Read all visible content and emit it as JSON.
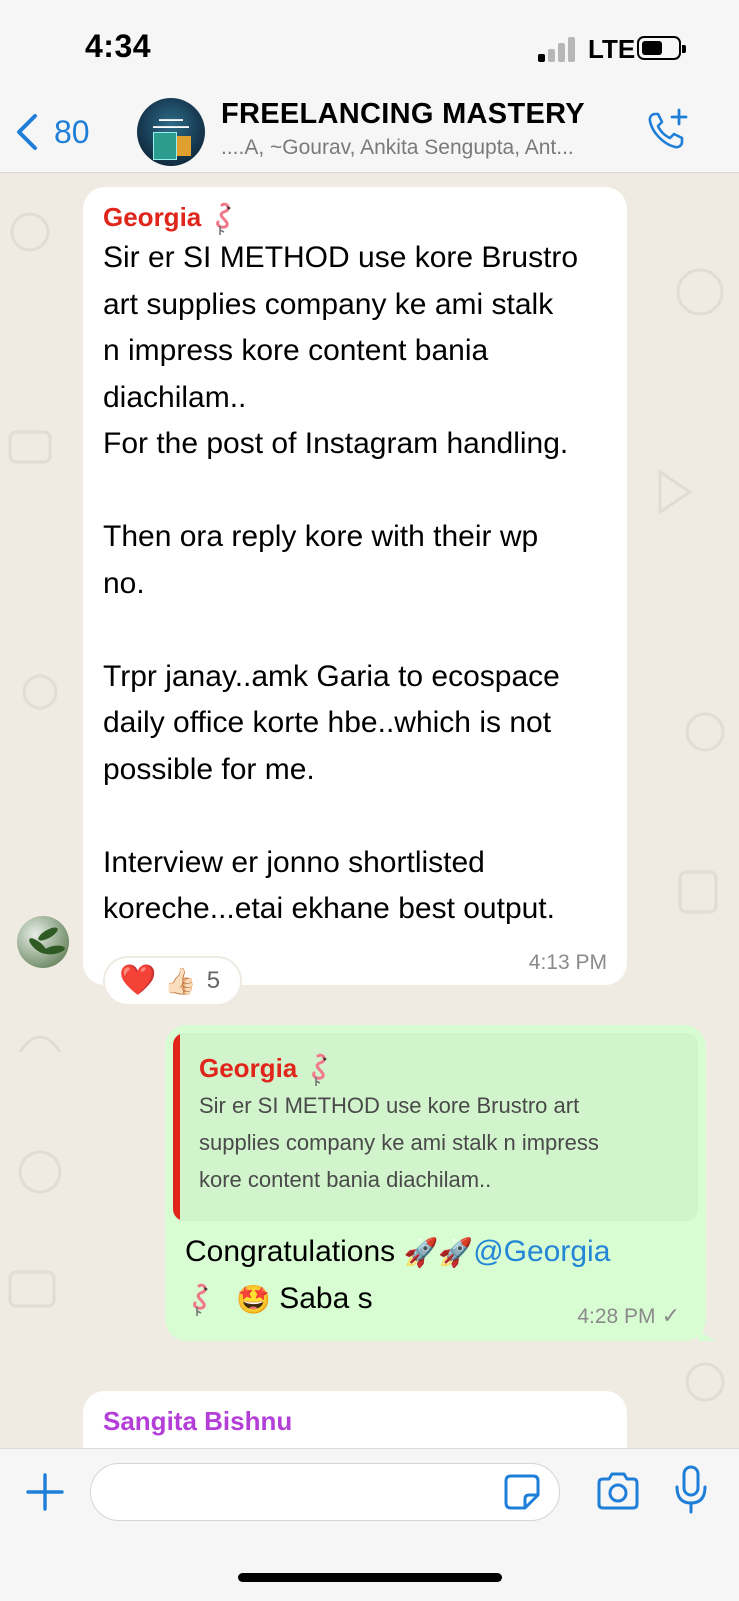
{
  "status_bar": {
    "time": "4:34",
    "network": "LTE"
  },
  "header": {
    "back_count": "80",
    "group_name": "FREELANCING MASTERY",
    "members": "....A, ~Gourav, Ankita Sengupta, Ant..."
  },
  "messages": [
    {
      "sender": "Georgia",
      "sender_emoji": "flamingo-icon",
      "text": "Sir er SI METHOD use kore Brustro\nart supplies company ke ami stalk\nn impress kore content bania\ndiachilam..\nFor the post of Instagram handling.\n\nThen ora reply kore with their wp\nno.\n\nTrpr janay..amk Garia to ecospace\ndaily office korte hbe..which is not\npossible for me.\n\nInterview er jonno shortlisted\nkoreche...etai ekhane best output.",
      "time": "4:13 PM",
      "reactions": {
        "heart": "❤️",
        "thumb": "👍🏻",
        "count": "5"
      }
    },
    {
      "quote": {
        "sender": "Georgia",
        "text": "Sir er SI METHOD use kore Brustro art\nsupplies company ke ami stalk n impress\nkore content bania diachilam.."
      },
      "text_before": "Congratulations ",
      "emoji_rockets": "🚀🚀",
      "mention": "@Georgia",
      "emoji_star": "🤩",
      "text_after": " Saba s",
      "time": "4:28 PM",
      "status": "✓"
    },
    {
      "sender": "Sangita Bishnu"
    }
  ],
  "input": {
    "placeholder": "",
    "value": ""
  },
  "colors": {
    "accent": "#1f7fd8",
    "sender_georgia": "#e0251b",
    "sender_sangita": "#b43fd8",
    "outgoing_bubble": "#d9fdd3",
    "chat_background": "#efeae2"
  }
}
